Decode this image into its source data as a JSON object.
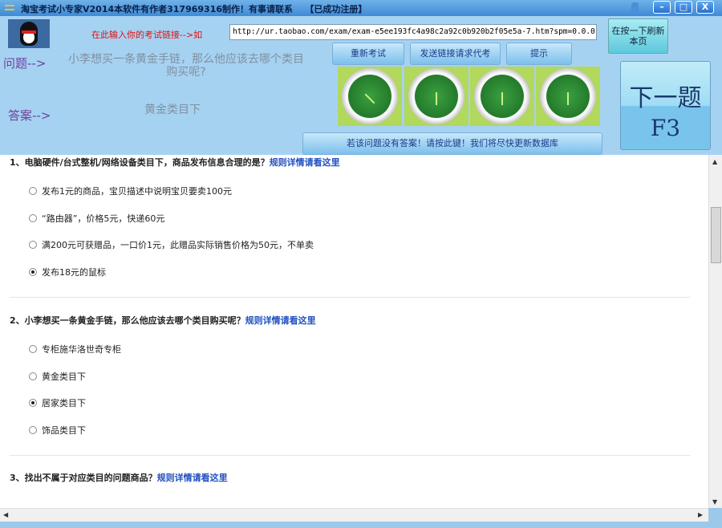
{
  "window": {
    "title": "淘宝考试小专家V2014本软件有作者317969316制作！有事请联系    【已成功注册】",
    "min": "–",
    "max": "□",
    "close": "X"
  },
  "top": {
    "hint": "在此输入你的考试链接-->如",
    "url": "http://ur.taobao.com/exam/exam-e5ee193fc4a98c2a92c0b920b2f05e5a-7.htm?spm=0.0.0.0",
    "refresh": "在按一下刷新本页",
    "question_label": "问题-->",
    "question": "小李想买一条黄金手链，那么他应该去哪个类目购买呢?",
    "answer_label": "答案-->",
    "answer": "黄金类目下",
    "buttons": {
      "restart": "重新考试",
      "send": "发送链接请求代考",
      "tip": "提示"
    },
    "report": "若该问题没有答案！请按此键！我们将尽快更新数据库",
    "next": {
      "line1": "下一题",
      "line2": "F3"
    }
  },
  "questions": [
    {
      "title": "1、电脑硬件/台式整机/网络设备类目下，商品发布信息合理的是？",
      "link": "规则详情请看这里",
      "selected": 3,
      "options": [
        "发布1元的商品，宝贝描述中说明宝贝要卖100元",
        "“路由器”，价格5元，快递60元",
        "满200元可获赠品，一口价1元，此赠品实际销售价格为50元，不单卖",
        "发布18元的鼠标"
      ]
    },
    {
      "title": "2、小李想买一条黄金手链，那么他应该去哪个类目购买呢？",
      "link": "规则详情请看这里",
      "selected": 2,
      "options": [
        "专柜施华洛世奇专柜",
        "黄金类目下",
        "居家类目下",
        "饰品类目下"
      ]
    },
    {
      "title": "3、找出不属于对应类目的问题商品？",
      "link": "规则详情请看这里",
      "options": []
    }
  ]
}
